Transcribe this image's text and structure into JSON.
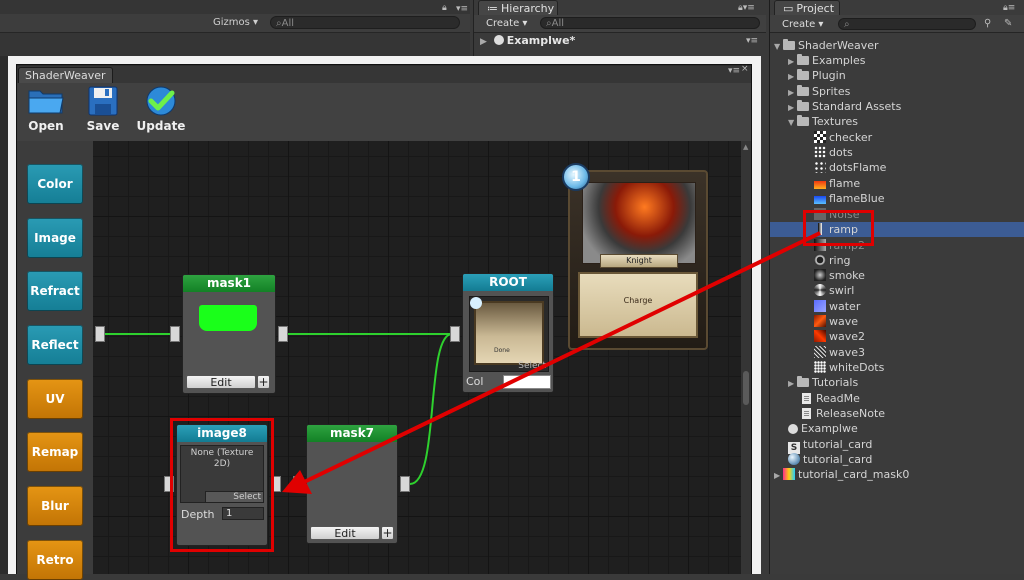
{
  "scene": {
    "gizmos_label": "Gizmos ▾",
    "search_placeholder": "All"
  },
  "hierarchy": {
    "tab_label": "Hierarchy",
    "create_label": "Create ▾",
    "search_placeholder": "All",
    "scene_name": "Examplwe*"
  },
  "project": {
    "tab_label": "Project",
    "create_label": "Create ▾",
    "tree": {
      "root": "ShaderWeaver",
      "examples": "Examples",
      "plugin": "Plugin",
      "sprites": "Sprites",
      "standard_assets": "Standard Assets",
      "textures": "Textures",
      "textures_items": [
        "checker",
        "dots",
        "dotsFlame",
        "flame",
        "flameBlue",
        "Noise",
        "ramp",
        "ramp2",
        "ring",
        "smoke",
        "swirl",
        "water",
        "wave",
        "wave2",
        "wave3",
        "whiteDots"
      ],
      "tutorials": "Tutorials",
      "readme": "ReadMe",
      "release_note": "ReleaseNote",
      "examplwe": "Examplwe",
      "tutorial_card_shader": "tutorial_card",
      "tutorial_card_material": "tutorial_card",
      "tutorial_card_mask0": "tutorial_card_mask0"
    },
    "selected_item": "ramp"
  },
  "shaderweaver": {
    "tab_label": "ShaderWeaver",
    "toolbar": {
      "open_label": "Open",
      "save_label": "Save",
      "update_label": "Update"
    },
    "sidebar": [
      {
        "label": "Color",
        "kind": "teal"
      },
      {
        "label": "Image",
        "kind": "teal"
      },
      {
        "label": "Refract",
        "kind": "teal"
      },
      {
        "label": "Reflect",
        "kind": "teal"
      },
      {
        "label": "UV",
        "kind": "orange"
      },
      {
        "label": "Remap",
        "kind": "orange"
      },
      {
        "label": "Blur",
        "kind": "orange"
      },
      {
        "label": "Retro",
        "kind": "orange"
      }
    ],
    "nodes": {
      "mask1": {
        "title": "mask1",
        "edit_label": "Edit",
        "plus_label": "+"
      },
      "root": {
        "title": "ROOT",
        "color_label": "Col",
        "select_label": "Select",
        "card_text": "Done"
      },
      "image8": {
        "title": "image8",
        "texture_label": "None (Texture 2D)",
        "select_label": "Select",
        "depth_label": "Depth",
        "depth_value": "1"
      },
      "mask7": {
        "title": "mask7",
        "edit_label": "Edit",
        "plus_label": "+"
      }
    },
    "preview": {
      "card_name": "Knight",
      "card_subtitle": "Charge",
      "gem_value": "1"
    }
  },
  "colors": {
    "teal": "#1e8ea6",
    "orange": "#d9860c",
    "node_green": "#1f9a34",
    "wire": "#2ed12e",
    "highlight": "#e00000",
    "selection": "#3c5c94"
  }
}
